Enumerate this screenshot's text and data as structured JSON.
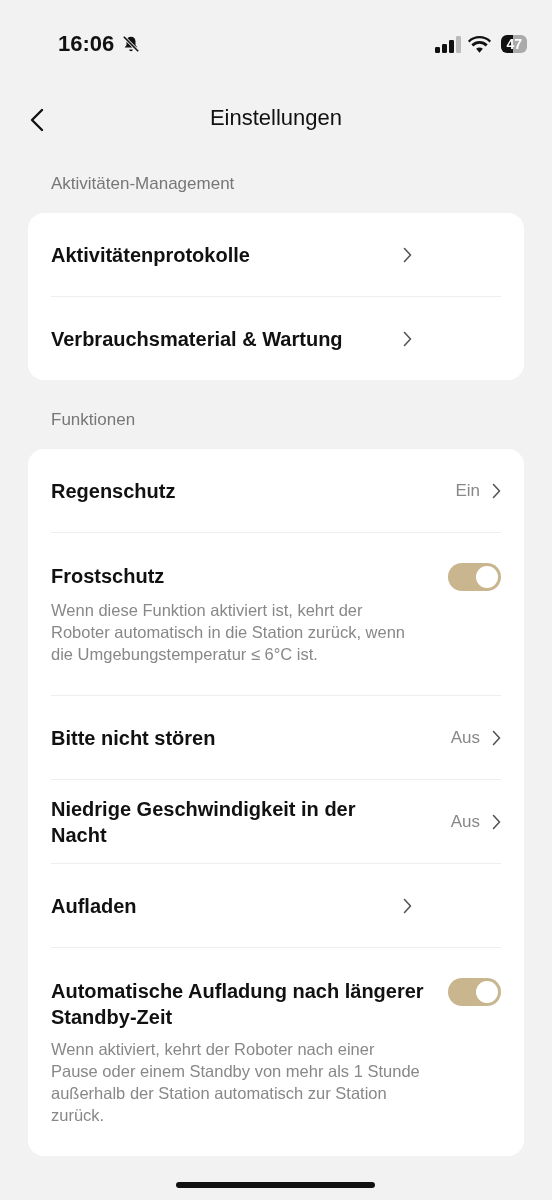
{
  "status_bar": {
    "time": "16:06",
    "battery": "47"
  },
  "header": {
    "title": "Einstellungen"
  },
  "sections": [
    {
      "title": "Aktivitäten-Management",
      "items": [
        {
          "kind": "link",
          "label": "Aktivitätenprotokolle"
        },
        {
          "kind": "link",
          "label": "Verbrauchsmaterial & Wartung"
        }
      ]
    },
    {
      "title": "Funktionen",
      "items": [
        {
          "kind": "link",
          "label": "Regenschutz",
          "value": "Ein"
        },
        {
          "kind": "toggle",
          "label": "Frostschutz",
          "on": true,
          "description": "Wenn diese Funktion aktiviert ist, kehrt der Roboter automatisch in die Station zurück, wenn die Umgebungstemperatur ≤ 6°C ist."
        },
        {
          "kind": "link",
          "label": "Bitte nicht stören",
          "value": "Aus"
        },
        {
          "kind": "link",
          "label": "Niedrige Geschwindigkeit in der Nacht",
          "value": "Aus"
        },
        {
          "kind": "link",
          "label": "Aufladen"
        },
        {
          "kind": "toggle",
          "label": "Automatische Aufladung nach längerer Standby-Zeit",
          "on": true,
          "description": "Wenn aktiviert, kehrt der Roboter nach einer Pause oder einem Standby von mehr als 1 Stunde außerhalb der Station automatisch zur Station zurück."
        }
      ]
    }
  ]
}
